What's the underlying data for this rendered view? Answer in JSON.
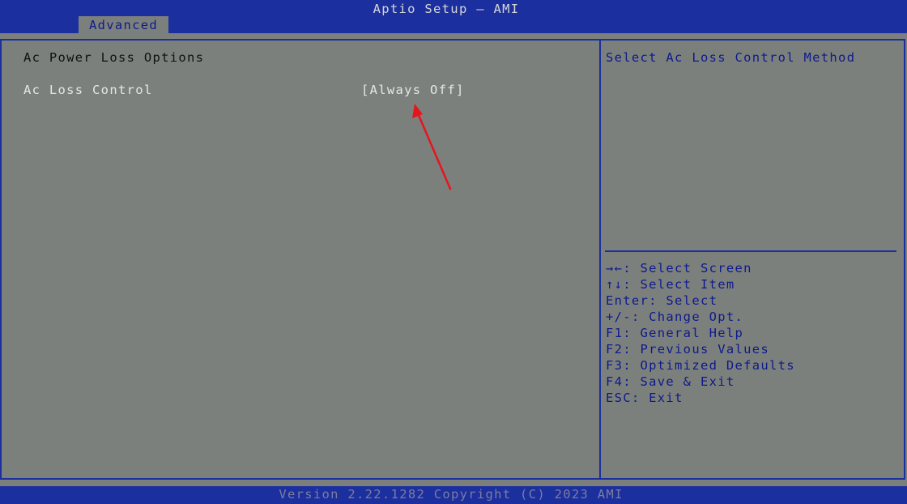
{
  "app": {
    "title": "Aptio Setup – AMI"
  },
  "tabs": [
    {
      "label": "Advanced",
      "active": true
    }
  ],
  "main": {
    "section_title": "Ac Power Loss Options",
    "settings": [
      {
        "label": "Ac Loss Control",
        "value": "[Always Off]"
      }
    ]
  },
  "help": {
    "text": "Select Ac Loss Control Method",
    "keys": [
      "→←: Select Screen",
      "↑↓: Select Item",
      "Enter: Select",
      "+/-: Change Opt.",
      "F1: General Help",
      "F2: Previous Values",
      "F3: Optimized Defaults",
      "F4: Save & Exit",
      "ESC: Exit"
    ]
  },
  "footer": {
    "version": "Version 2.22.1282 Copyright (C) 2023 AMI"
  },
  "colors": {
    "header_blue": "#1c2f9e",
    "panel_gray": "#7c807d",
    "help_text": "#0e1a8c",
    "annotation_red": "#e8141c"
  }
}
